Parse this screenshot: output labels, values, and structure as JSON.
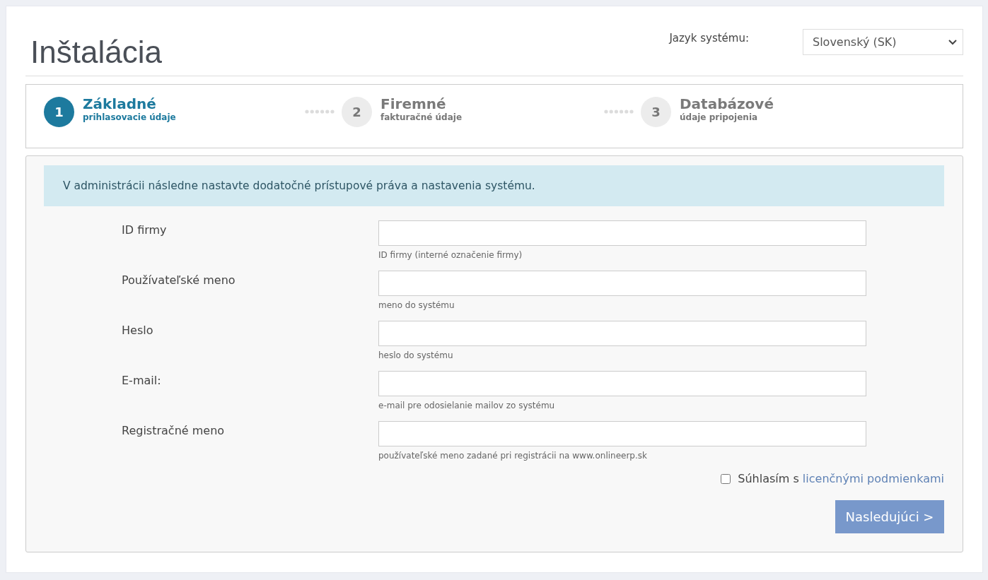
{
  "title": "Inštalácia",
  "language": {
    "label": "Jazyk systému:",
    "value": "Slovenský (SK)"
  },
  "steps": [
    {
      "number": "1",
      "title": "Základné",
      "subtitle": "prihlasovacie údaje",
      "selected": true
    },
    {
      "number": "2",
      "title": "Firemné",
      "subtitle": "fakturačné údaje",
      "selected": false
    },
    {
      "number": "3",
      "title": "Databázové",
      "subtitle": "údaje pripojenia",
      "selected": false
    }
  ],
  "alert": "V administrácii následne nastavte dodatočné prístupové práva a nastavenia systému.",
  "fields": [
    {
      "label": "ID firmy",
      "help": "ID firmy (interné označenie firmy)"
    },
    {
      "label": "Používateľské meno",
      "help": "meno do systému"
    },
    {
      "label": "Heslo",
      "help": "heslo do systému"
    },
    {
      "label": "E-mail:",
      "help": "e-mail pre odosielanie mailov zo systému"
    },
    {
      "label": "Registračné meno",
      "help": "používateľské meno zadané pri registrácii na www.onlineerp.sk"
    }
  ],
  "agree": {
    "text": "Súhlasím s",
    "link": "licenčnými podmienkami",
    "checked": false
  },
  "next_button": "Nasledujúci >"
}
